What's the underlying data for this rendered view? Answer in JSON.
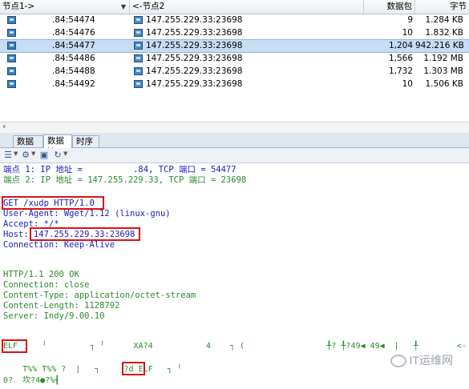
{
  "table": {
    "columns": [
      "节点1->",
      "<-节点2",
      "数据包",
      "字节"
    ],
    "rows": [
      {
        "node1": ".84:54474",
        "node2": "147.255.229.33:23698",
        "packets": "9",
        "bytes": "1.284 KB",
        "selected": false
      },
      {
        "node1": ".84:54476",
        "node2": "147.255.229.33:23698",
        "packets": "10",
        "bytes": "1.832 KB",
        "selected": false
      },
      {
        "node1": ".84:54477",
        "node2": "147.255.229.33:23698",
        "packets": "1,204",
        "bytes": "942.216 KB",
        "selected": true
      },
      {
        "node1": ".84:54486",
        "node2": "147.255.229.33:23698",
        "packets": "1,566",
        "bytes": "1.192 MB",
        "selected": false
      },
      {
        "node1": ".84:54488",
        "node2": "147.255.229.33:23698",
        "packets": "1,732",
        "bytes": "1.303 MB",
        "selected": false
      },
      {
        "node1": ".84:54492",
        "node2": "147.255.229.33:23698",
        "packets": "10",
        "bytes": "1.506 KB",
        "selected": false
      }
    ]
  },
  "tabs": [
    "数据包",
    "数据流",
    "时序图"
  ],
  "active_tab": "数据流",
  "stream": {
    "endpoint1": "端点 1: IP 地址 =          .84, TCP 端口 = 54477",
    "endpoint2": "端点 2: IP 地址 = 147.255.229.33, TCP 端口 = 23698",
    "request": [
      "GET /xudp HTTP/1.0",
      "User-Agent: Wget/1.12 (linux-gnu)",
      "Accept: */*",
      "Host: 147.255.229.33:23698",
      "Connection: Keep-Alive"
    ],
    "response": [
      "HTTP/1.1 200 OK",
      "Connection: close",
      "Content-Type: application/octet-stream",
      "Content-Length: 1128792",
      "Server: Indy/9.00.10"
    ],
    "binary": [
      "ELF     ╵         ┐ ╵      XA?4           4    ┐ (                 ╀? ╀?49◀ 49◀  |   ╀        <-  <-*",
      "    T%% T%% ?  |   ┐     ?d ELF   ┐ ╵",
      "0?  坎?4●?%┨"
    ]
  },
  "watermark": "IT运维网"
}
